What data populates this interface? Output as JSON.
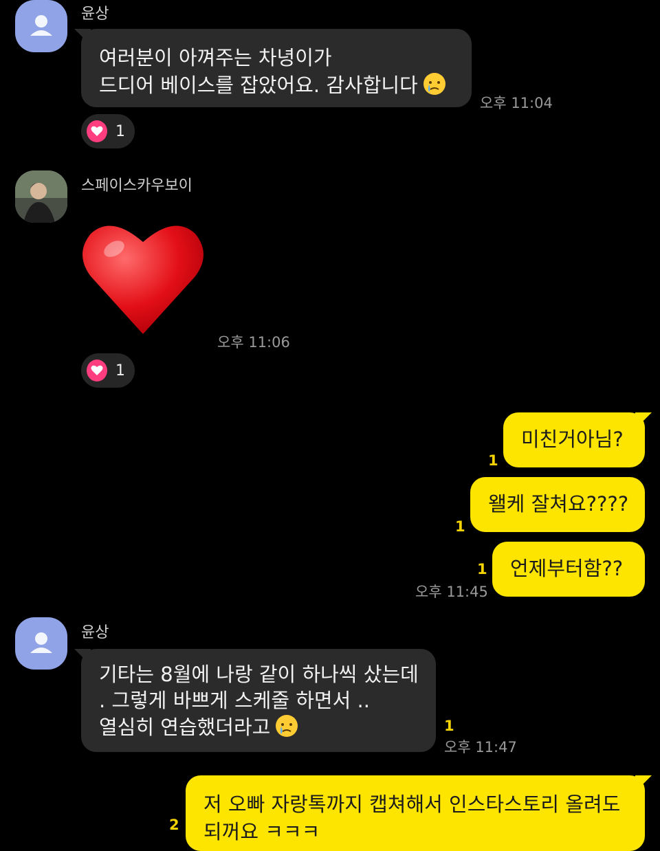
{
  "messages": [
    {
      "sender": "윤상",
      "lines": [
        "여러분이 아껴주는 차녕이가",
        "드디어 베이스를 잡았어요. 감사합니다"
      ],
      "emoji": "crying-face",
      "time": "오후 11:04",
      "reaction": {
        "icon": "heart-icon",
        "count": "1"
      }
    },
    {
      "sender": "스페이스카우보이",
      "emoji": "red-heart",
      "time": "오후 11:06",
      "reaction": {
        "icon": "heart-icon",
        "count": "1"
      }
    },
    {
      "outgoing": [
        {
          "text": "미친거아님?",
          "unread": "1"
        },
        {
          "text": "왤케 잘쳐요????",
          "unread": "1"
        },
        {
          "text": "언제부터함??",
          "unread": "1"
        }
      ],
      "time": "오후 11:45"
    },
    {
      "sender": "윤상",
      "lines": [
        "기타는 8월에 나랑 같이 하나씩 샀는데",
        ". 그렇게 바쁘게 스케줄 하면서 ..",
        "열심히 연습했더라고"
      ],
      "emoji": "crying-face",
      "unread": "1",
      "time": "오후 11:47"
    },
    {
      "outgoing_text": "저 오빠 자랑톡까지 캡쳐해서 인스타스토리 올려도",
      "outgoing_text_2": "되꺼요 ㅋㅋㅋ",
      "unread": "2"
    }
  ],
  "colors": {
    "background": "#000000",
    "incoming_bubble": "#2b2b2b",
    "outgoing_bubble": "#fde500",
    "unread": "#f5d300",
    "reaction_heart": "#ff3d7f",
    "default_avatar": "#8fa3e6"
  }
}
